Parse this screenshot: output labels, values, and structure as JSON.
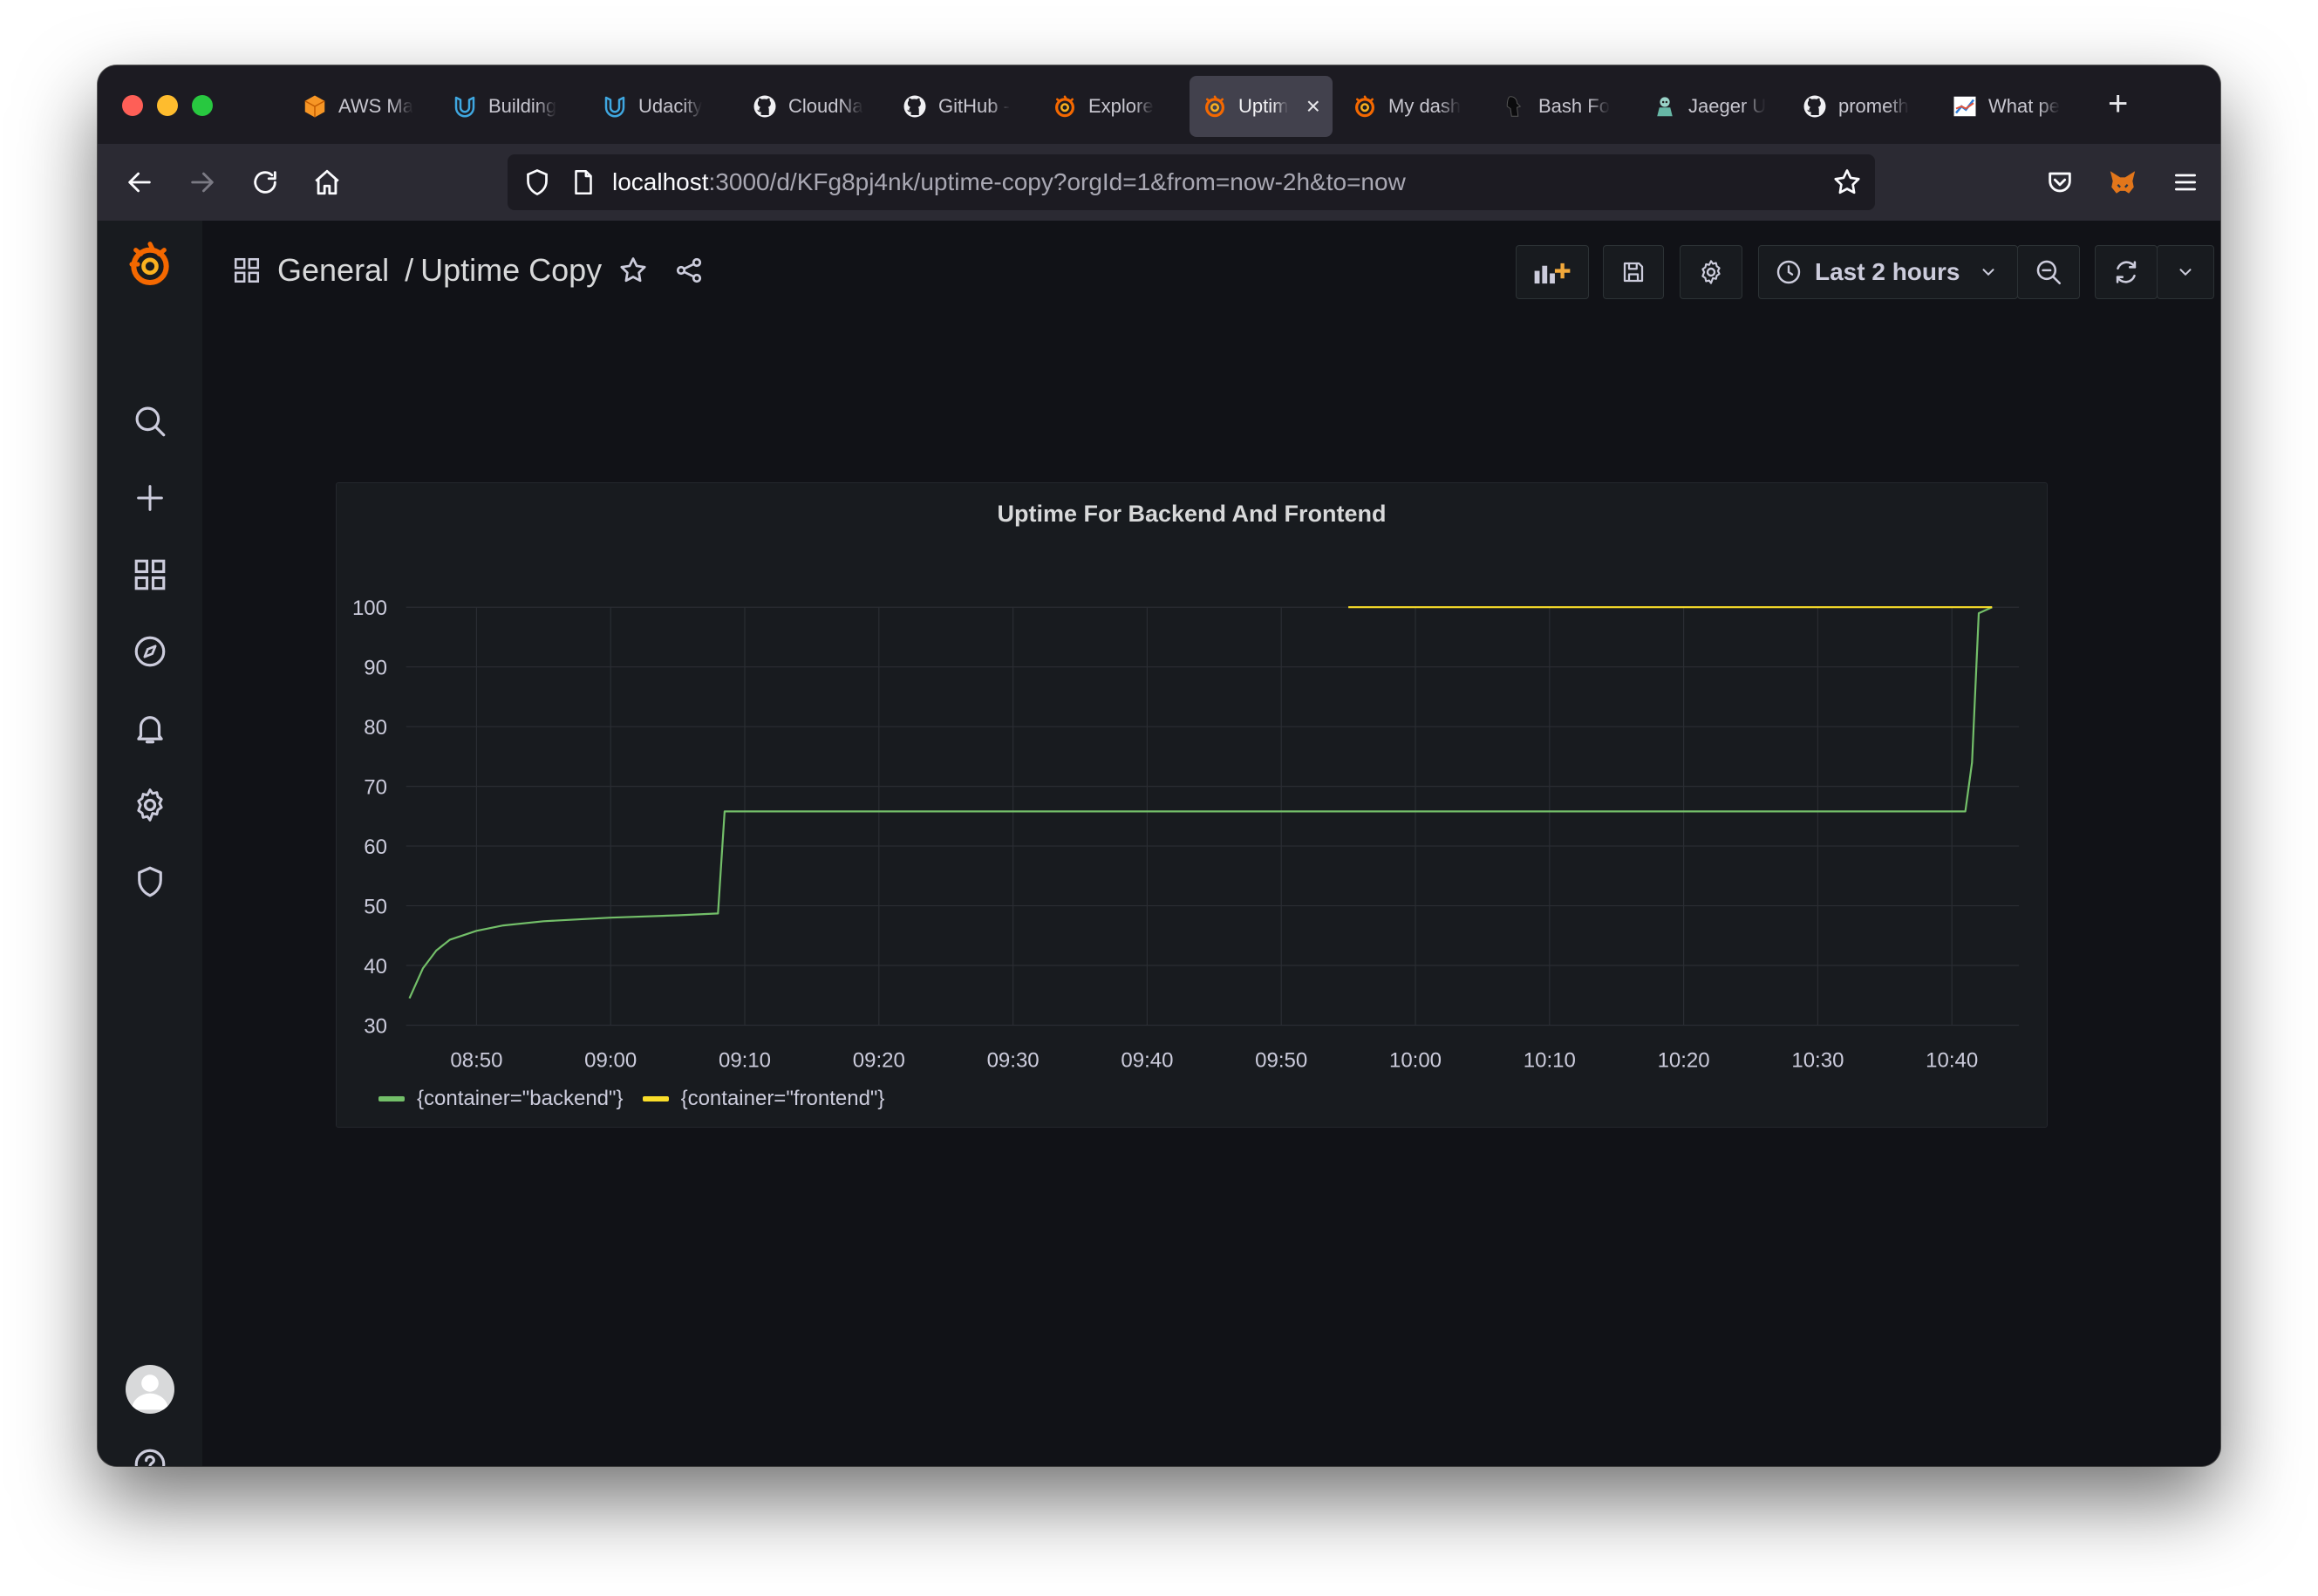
{
  "browser": {
    "tabs": [
      {
        "label": "AWS Ma",
        "icon": "aws-cube-icon",
        "active": false
      },
      {
        "label": "Building",
        "icon": "udacity-icon",
        "active": false
      },
      {
        "label": "Udacity",
        "icon": "udacity-icon",
        "active": false
      },
      {
        "label": "CloudNa",
        "icon": "github-icon",
        "active": false
      },
      {
        "label": "GitHub -",
        "icon": "github-icon",
        "active": false
      },
      {
        "label": "Explore",
        "icon": "grafana-icon",
        "active": false
      },
      {
        "label": "Uptim",
        "icon": "grafana-icon",
        "active": true
      },
      {
        "label": "My dash",
        "icon": "grafana-icon",
        "active": false
      },
      {
        "label": "Bash Fo",
        "icon": "bash-icon",
        "active": false
      },
      {
        "label": "Jaeger U",
        "icon": "jaeger-icon",
        "active": false
      },
      {
        "label": "prometh",
        "icon": "github-icon",
        "active": false
      },
      {
        "label": "What pe",
        "icon": "chart-thumb-icon",
        "active": false
      }
    ],
    "close_glyph": "×",
    "new_tab_glyph": "+",
    "url_host": "localhost",
    "url_rest": ":3000/d/KFg8pj4nk/uptime-copy?orgId=1&from=now-2h&to=now"
  },
  "dashboard": {
    "folder": "General",
    "separator": "/",
    "title": "Uptime Copy",
    "time_range": "Last 2 hours"
  },
  "colors": {
    "backend": "#73bf69",
    "frontend": "#fade2a",
    "grafana_orange": "#f46800"
  },
  "chart_data": {
    "type": "line",
    "title": "Uptime For Backend And Frontend",
    "xlabel": "",
    "ylabel": "",
    "ylim": [
      30,
      100
    ],
    "yticks": [
      "100",
      "90",
      "80",
      "70",
      "60",
      "50",
      "40",
      "30"
    ],
    "xticks": [
      "08:50",
      "09:00",
      "09:10",
      "09:20",
      "09:30",
      "09:40",
      "09:50",
      "10:00",
      "10:10",
      "10:20",
      "10:30",
      "10:40"
    ],
    "xlim": [
      "08:44:45",
      "10:45"
    ],
    "grid": true,
    "legend_position": "bottom-left",
    "series": [
      {
        "name": "{container=\"backend\"}",
        "color": "#73bf69",
        "points": [
          [
            "08:45",
            34.5
          ],
          [
            "08:46",
            39.5
          ],
          [
            "08:47",
            42.5
          ],
          [
            "08:48",
            44.3
          ],
          [
            "08:50",
            45.8
          ],
          [
            "08:52",
            46.7
          ],
          [
            "08:55",
            47.4
          ],
          [
            "09:00",
            48.0
          ],
          [
            "09:05",
            48.4
          ],
          [
            "09:08",
            48.7
          ],
          [
            "09:08:30",
            65.8
          ],
          [
            "09:20",
            65.8
          ],
          [
            "09:40",
            65.8
          ],
          [
            "10:00",
            65.8
          ],
          [
            "10:20",
            65.8
          ],
          [
            "10:41",
            65.8
          ],
          [
            "10:41:30",
            74.0
          ],
          [
            "10:42",
            99.0
          ],
          [
            "10:43",
            100
          ]
        ]
      },
      {
        "name": "{container=\"frontend\"}",
        "color": "#fade2a",
        "points": [
          [
            "09:55",
            100
          ],
          [
            "10:10",
            100
          ],
          [
            "10:30",
            100
          ],
          [
            "10:43",
            100
          ]
        ]
      }
    ]
  }
}
